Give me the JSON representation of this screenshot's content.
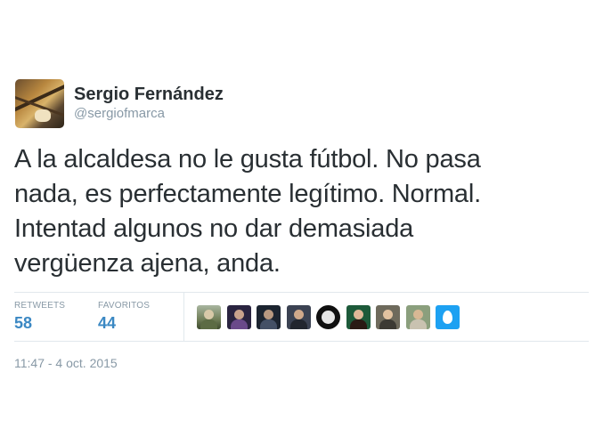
{
  "tweet": {
    "display_name": "Sergio Fernández",
    "handle": "@sergiofmarca",
    "text_lines": [
      "A la alcaldesa no le gusta fútbol. No pasa",
      "nada, es perfectamente legítimo. Normal.",
      "Intentad algunos no dar demasiada",
      "vergüenza ajena, anda."
    ],
    "timestamp": "11:47 - 4 oct. 2015"
  },
  "stats": {
    "retweets_label": "RETWEETS",
    "retweets_count": "58",
    "favorites_label": "FAVORITOS",
    "favorites_count": "44"
  },
  "likers": [
    {
      "icon": "user-avatar-icon"
    },
    {
      "icon": "user-avatar-icon"
    },
    {
      "icon": "user-avatar-icon"
    },
    {
      "icon": "user-avatar-icon"
    },
    {
      "icon": "user-avatar-icon"
    },
    {
      "icon": "user-avatar-icon"
    },
    {
      "icon": "user-avatar-icon"
    },
    {
      "icon": "user-avatar-icon"
    },
    {
      "icon": "default-egg-avatar-icon"
    }
  ],
  "colors": {
    "accent": "#3b88c3",
    "muted": "#8899a6",
    "text": "#292f33",
    "border": "#e1e8ed"
  }
}
